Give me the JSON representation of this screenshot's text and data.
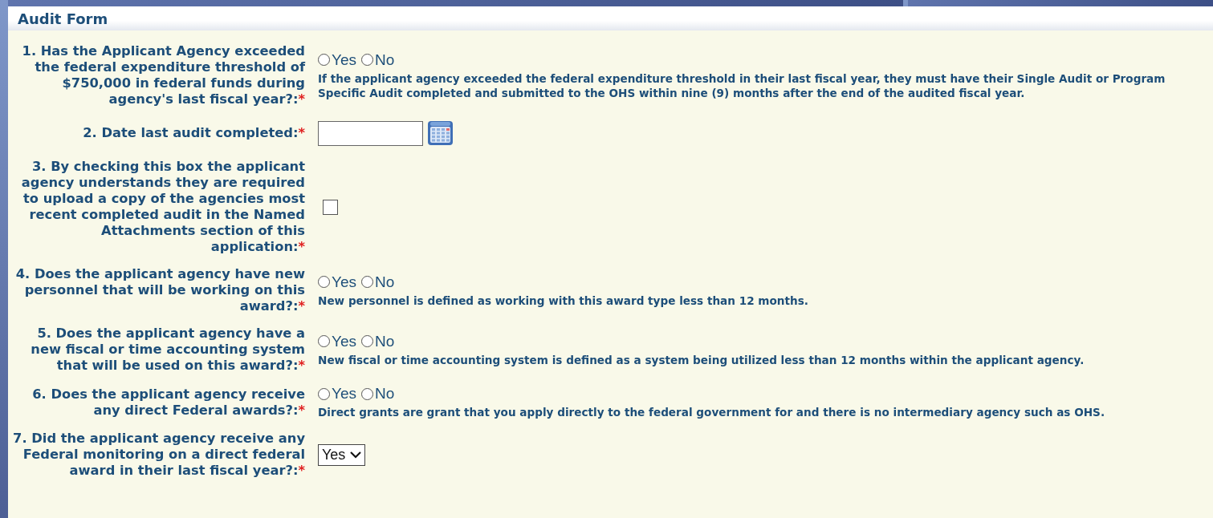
{
  "panel": {
    "title": "Audit Form"
  },
  "questions": [
    {
      "kind": "radio",
      "label": "1. Has the Applicant Agency exceeded the federal expenditure threshold of $750,000 in federal funds during agency's last fiscal year?:",
      "required_mark": "*",
      "options": [
        {
          "label": "Yes",
          "selected": false
        },
        {
          "label": "No",
          "selected": false
        }
      ],
      "help": "If the applicant agency exceeded the federal expenditure threshold in their last fiscal year, they must have their Single Audit or Program Specific Audit completed and submitted to the OHS within nine (9) months after the end of the audited fiscal year."
    },
    {
      "kind": "date",
      "label": "2. Date last audit completed:",
      "required_mark": "*"
    },
    {
      "kind": "checkbox",
      "label": "3. By checking this box the applicant agency understands they are required to upload a copy of the agencies most recent completed audit in the Named Attachments section of this application:",
      "required_mark": "*",
      "checked": false
    },
    {
      "kind": "radio",
      "label": "4. Does the applicant agency have new personnel that will be working on this award?:",
      "required_mark": "*",
      "options": [
        {
          "label": "Yes",
          "selected": false
        },
        {
          "label": "No",
          "selected": false
        }
      ],
      "help": "New personnel is defined as working with this award type less than 12 months."
    },
    {
      "kind": "radio",
      "label": "5. Does the applicant agency have a new fiscal or time accounting system that will be used on this award?:",
      "required_mark": "*",
      "options": [
        {
          "label": "Yes",
          "selected": false
        },
        {
          "label": "No",
          "selected": false
        }
      ],
      "help": "New fiscal or time accounting system is defined as a system being utilized less than 12 months within the applicant agency."
    },
    {
      "kind": "radio",
      "label": "6. Does the applicant agency receive any direct Federal awards?:",
      "required_mark": "*",
      "options": [
        {
          "label": "Yes",
          "selected": false
        },
        {
          "label": "No",
          "selected": false
        }
      ],
      "help": "Direct grants are grant that you apply directly to the federal government for and there is no intermediary agency such as OHS."
    },
    {
      "kind": "select",
      "label": "7. Did the applicant agency receive any Federal monitoring on a direct federal award in their last fiscal year?:",
      "required_mark": "*",
      "value": "Yes"
    }
  ]
}
